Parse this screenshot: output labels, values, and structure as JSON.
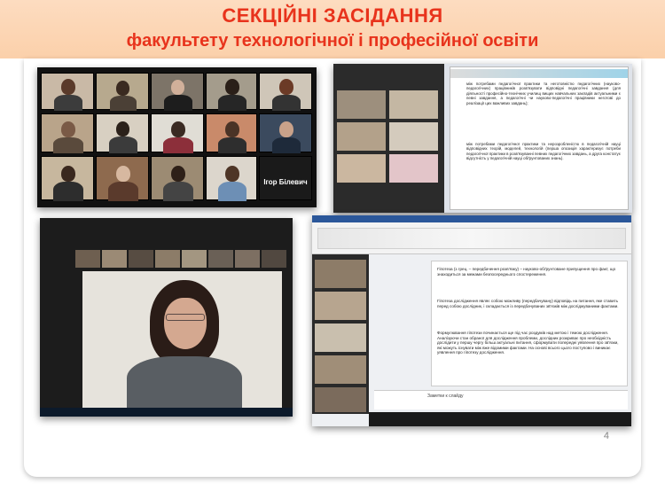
{
  "header": {
    "title_line1": "СЕКЦІЙНІ ЗАСІДАННЯ",
    "title_line2": "факультету технологічної і професійної освіти"
  },
  "page_number": "4",
  "gallery": {
    "featured_participant": "Ігор Білевич"
  },
  "slide_text": {
    "p1": "між потребами педагогічної практики та неготовністю педагогічних (науково-педагогічних) працівників розв'язувати відповідні педагогічні завдання (для діяльності професійно-технічних училищ вищих навчальних закладів актуальними є певні завдання, а педагогічні чи науково-педагогічні працівники неготові до реалізації цих важливих завдань);",
    "p2": "між потребами педагогічної практики та нерозробленістю в педагогічній науці відповідних теорій, моделей, технологій (перша опозиція характеризує потреби педагогічної практики в розв'язуванні певних педагогічних завдань, а друга констатує відсутність у педагогічній науці обґрунтованих знань)."
  },
  "doc_text": {
    "p1": "Гіпотеза (з грец. – передбачення розв'язку) – науково-обґрунтоване припущення про факт, що знаходиться за межами безпосереднього спостереження.",
    "p2": "Гіпотеза дослідження являє собою можливу (передбачувану) відповідь на питання, яке ставить перед собою дослідник, і складається із передбачуваних зв'язків між досліджуваними фактами.",
    "p3": "Формулювання гіпотези починається ще під час роздумів над метою і темою дослідження. Аналізуючи стан обраної для дослідження проблеми, дослідник розкриває про необхідність дослідити у першу чергу більш актуальні питання, сформувати попередні уявлення про зв'язки, які можуть існувати між вже відомими фактами. На основі всього цього поступово і виникає уявлення про гіпотезу дослідження.",
    "notes_placeholder": "Заметки к слайду"
  }
}
